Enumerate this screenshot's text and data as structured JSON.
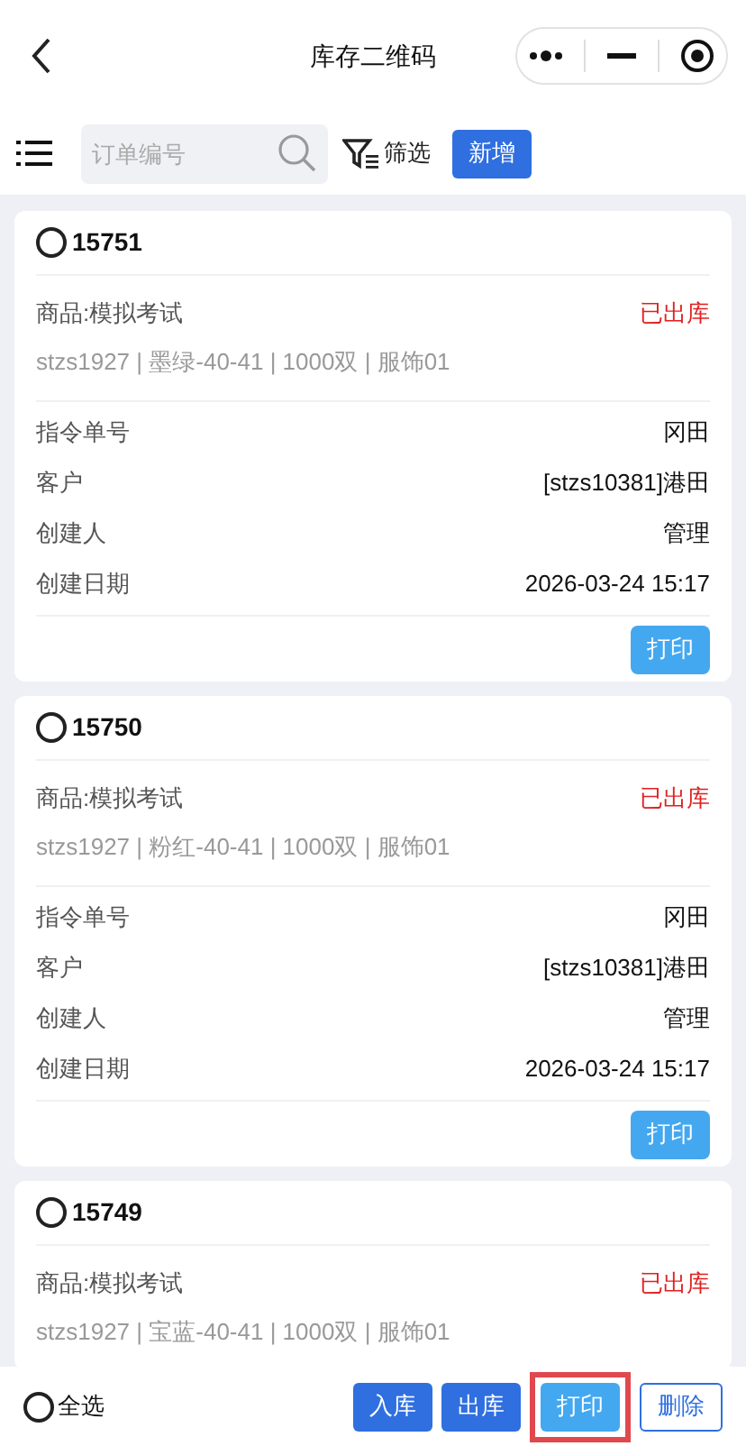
{
  "header": {
    "title": "库存二维码"
  },
  "toolbar": {
    "search": {
      "placeholder": "订单编号"
    },
    "filter_label": "筛选",
    "add_button": "新增"
  },
  "orders": [
    {
      "number": "15751",
      "selected": false,
      "product": "商品:模拟考试",
      "status": "已出库",
      "spec": "stzs1927 | 墨绿-40-41 | 1000双 | 服饰01",
      "fields": [
        {
          "label": "指令单号",
          "value": "冈田"
        },
        {
          "label": "客户",
          "value": "[stzs10381]港田"
        },
        {
          "label": "创建人",
          "value": "管理"
        },
        {
          "label": "创建日期",
          "value": "2026-03-24 15:17"
        }
      ],
      "print_button": "打印"
    },
    {
      "number": "15750",
      "selected": false,
      "product": "商品:模拟考试",
      "status": "已出库",
      "spec": "stzs1927 | 粉红-40-41 | 1000双 | 服饰01",
      "fields": [
        {
          "label": "指令单号",
          "value": "冈田"
        },
        {
          "label": "客户",
          "value": "[stzs10381]港田"
        },
        {
          "label": "创建人",
          "value": "管理"
        },
        {
          "label": "创建日期",
          "value": "2026-03-24 15:17"
        }
      ],
      "print_button": "打印"
    },
    {
      "number": "15749",
      "selected": false,
      "product": "商品:模拟考试",
      "status": "已出库",
      "spec": "stzs1927 | 宝蓝-40-41 | 1000双 | 服饰01"
    }
  ],
  "bottom_bar": {
    "select_all": {
      "label": "全选",
      "selected": false
    },
    "actions": [
      {
        "label": "入库",
        "kind": "solid",
        "highlighted": false
      },
      {
        "label": "出库",
        "kind": "solid",
        "highlighted": false
      },
      {
        "label": "打印",
        "kind": "light",
        "highlighted": true
      },
      {
        "label": "删除",
        "kind": "outline",
        "highlighted": false
      }
    ]
  }
}
